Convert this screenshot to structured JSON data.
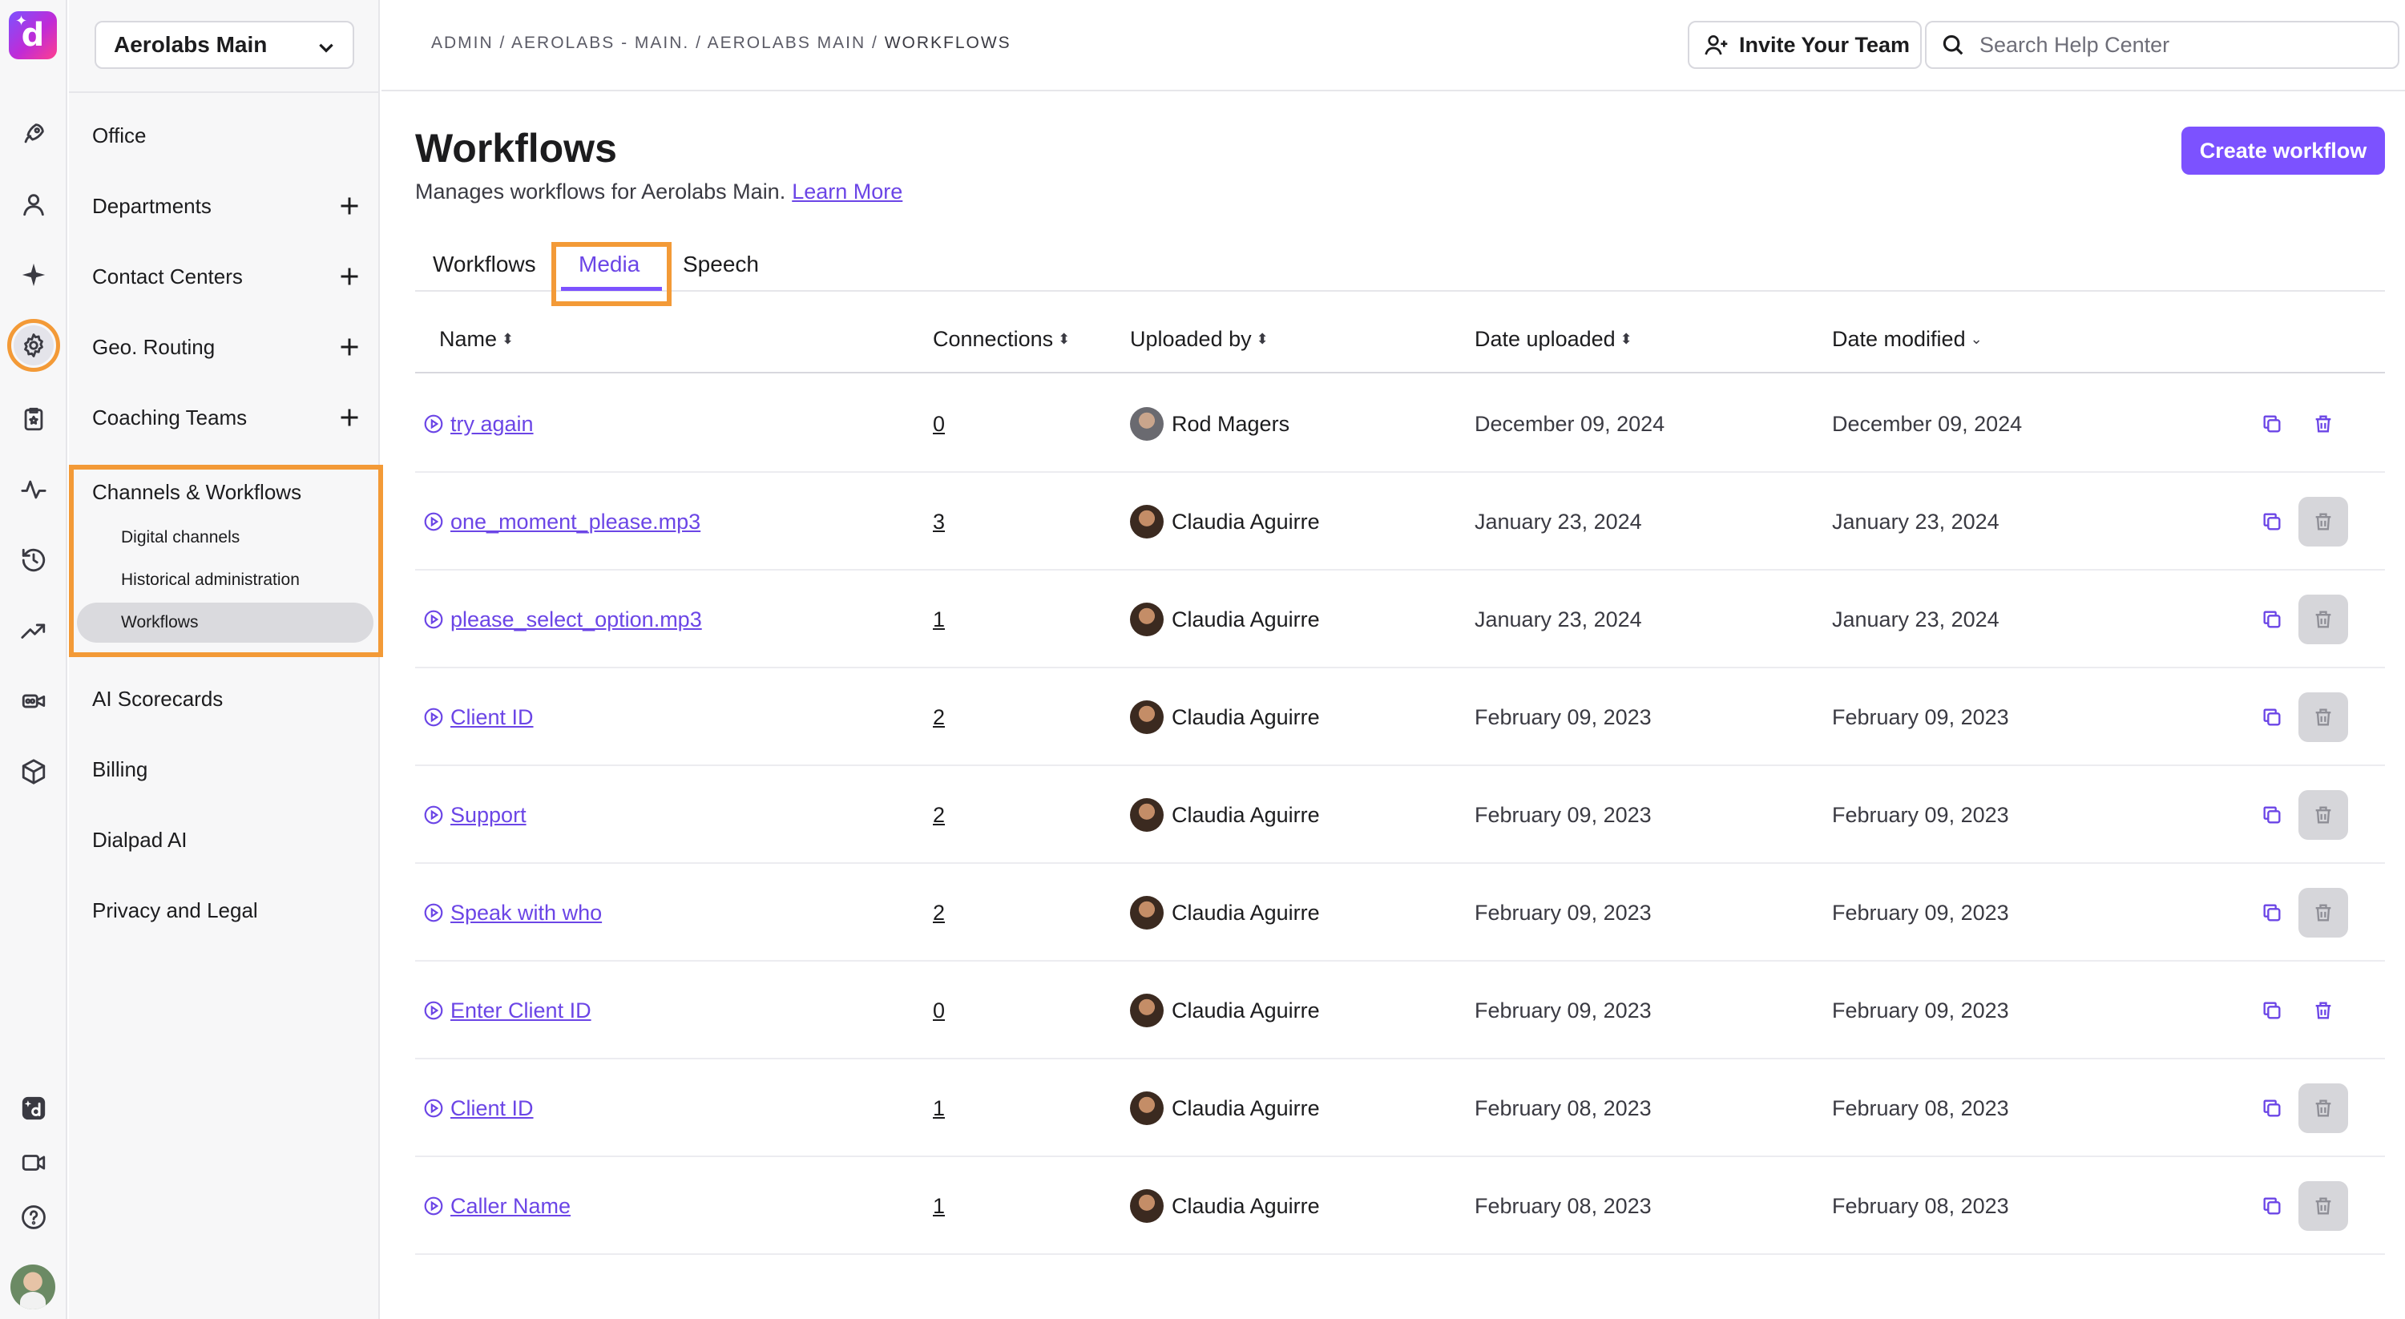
{
  "icons": {
    "logo": "dialpad-logo",
    "rail": [
      "rocket-icon",
      "person-icon",
      "sparkle-icon",
      "gear-icon",
      "clipboard-icon",
      "activity-icon",
      "history-icon",
      "trending-icon",
      "video-icon",
      "cube-icon"
    ],
    "rail_bottom": [
      "dialpad-ai-icon",
      "video-call-icon",
      "help-icon"
    ]
  },
  "colors": {
    "accent": "#7c52ff",
    "link": "#6b45e6",
    "highlight": "#f39a37"
  },
  "sidebar": {
    "org_selector": "Aerolabs Main",
    "items": [
      {
        "label": "Office",
        "has_add": false
      },
      {
        "label": "Departments",
        "has_add": true
      },
      {
        "label": "Contact Centers",
        "has_add": true
      },
      {
        "label": "Geo. Routing",
        "has_add": true
      },
      {
        "label": "Coaching Teams",
        "has_add": true
      }
    ],
    "group": {
      "label": "Channels & Workflows",
      "children": [
        "Digital channels",
        "Historical administration",
        "Workflows"
      ],
      "active_child": "Workflows"
    },
    "items_after": [
      "AI Scorecards",
      "Billing",
      "Dialpad AI",
      "Privacy and Legal"
    ]
  },
  "header": {
    "breadcrumb": [
      "ADMIN",
      "AEROLABS - MAIN.",
      "AEROLABS MAIN",
      "WORKFLOWS"
    ],
    "invite_label": "Invite Your Team",
    "search_placeholder": "Search Help Center"
  },
  "page": {
    "title": "Workflows",
    "subtitle": "Manages workflows for Aerolabs Main.",
    "learn_more": "Learn More",
    "create_label": "Create workflow",
    "tabs": [
      "Workflows",
      "Media",
      "Speech"
    ],
    "active_tab": "Media"
  },
  "table": {
    "columns": [
      {
        "label": "Name",
        "sort": "⬍"
      },
      {
        "label": "Connections",
        "sort": "⬍"
      },
      {
        "label": "Uploaded by",
        "sort": "⬍"
      },
      {
        "label": "Date uploaded",
        "sort": "⬍"
      },
      {
        "label": "Date modified",
        "sort": "⌄"
      }
    ],
    "rows": [
      {
        "name": "try again",
        "connections": "0",
        "uploaded_by": "Rod Magers",
        "date_uploaded": "December 09, 2024",
        "date_modified": "December 09, 2024",
        "delete_enabled": true
      },
      {
        "name": "one_moment_please.mp3",
        "connections": "3",
        "uploaded_by": "Claudia Aguirre",
        "date_uploaded": "January 23, 2024",
        "date_modified": "January 23, 2024",
        "delete_enabled": false
      },
      {
        "name": "please_select_option.mp3",
        "connections": "1",
        "uploaded_by": "Claudia Aguirre",
        "date_uploaded": "January 23, 2024",
        "date_modified": "January 23, 2024",
        "delete_enabled": false
      },
      {
        "name": "Client ID",
        "connections": "2",
        "uploaded_by": "Claudia Aguirre",
        "date_uploaded": "February 09, 2023",
        "date_modified": "February 09, 2023",
        "delete_enabled": false
      },
      {
        "name": "Support",
        "connections": "2",
        "uploaded_by": "Claudia Aguirre",
        "date_uploaded": "February 09, 2023",
        "date_modified": "February 09, 2023",
        "delete_enabled": false
      },
      {
        "name": "Speak with who",
        "connections": "2",
        "uploaded_by": "Claudia Aguirre",
        "date_uploaded": "February 09, 2023",
        "date_modified": "February 09, 2023",
        "delete_enabled": false
      },
      {
        "name": "Enter Client ID",
        "connections": "0",
        "uploaded_by": "Claudia Aguirre",
        "date_uploaded": "February 09, 2023",
        "date_modified": "February 09, 2023",
        "delete_enabled": true
      },
      {
        "name": "Client ID",
        "connections": "1",
        "uploaded_by": "Claudia Aguirre",
        "date_uploaded": "February 08, 2023",
        "date_modified": "February 08, 2023",
        "delete_enabled": false
      },
      {
        "name": "Caller Name",
        "connections": "1",
        "uploaded_by": "Claudia Aguirre",
        "date_uploaded": "February 08, 2023",
        "date_modified": "February 08, 2023",
        "delete_enabled": false
      }
    ]
  }
}
